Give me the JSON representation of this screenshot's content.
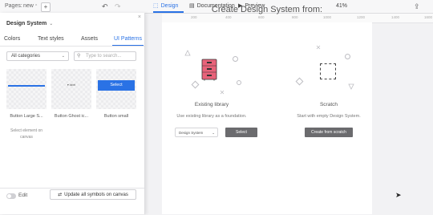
{
  "toolbar": {
    "pages_label": "Pages:",
    "page_name": "new",
    "add_page": "+",
    "undo": "↶",
    "redo": "↷",
    "tabs": {
      "design": "Design",
      "documentation": "Documentation",
      "preview": "Preview"
    },
    "zoom": "41%",
    "export_icon": "export-icon"
  },
  "canvas": {
    "title": "Create Design System from:",
    "ruler_ticks": [
      "200",
      "400",
      "600",
      "800",
      "1000",
      "1200",
      "1400",
      "1600"
    ],
    "existing": {
      "title": "Existing library",
      "subtitle": "Use existing library as a foundation.",
      "select_value": "Design System",
      "button": "Select"
    },
    "scratch": {
      "title": "Scratch",
      "subtitle": "Start with empty Design System.",
      "button": "Create from scratch"
    }
  },
  "panel": {
    "title": "Design System",
    "close": "×",
    "tabs": [
      "Colors",
      "Text styles",
      "Assets",
      "UI Patterns"
    ],
    "active_tab": "UI Patterns",
    "category_select": "All categories",
    "search_placeholder": "Type to search...",
    "items": [
      {
        "caption": "Button Large S...",
        "preview_label": ""
      },
      {
        "caption": "Button Ghost ic...",
        "preview_label": "♥ label"
      },
      {
        "caption": "Button small",
        "preview_label": "Select"
      }
    ],
    "empty_message": "Select element on canvas",
    "edit_label": "Edit",
    "update_button": "Update all symbols on canvas"
  },
  "colors": {
    "accent": "#2a72e5",
    "library_icon": "#e8637a"
  }
}
